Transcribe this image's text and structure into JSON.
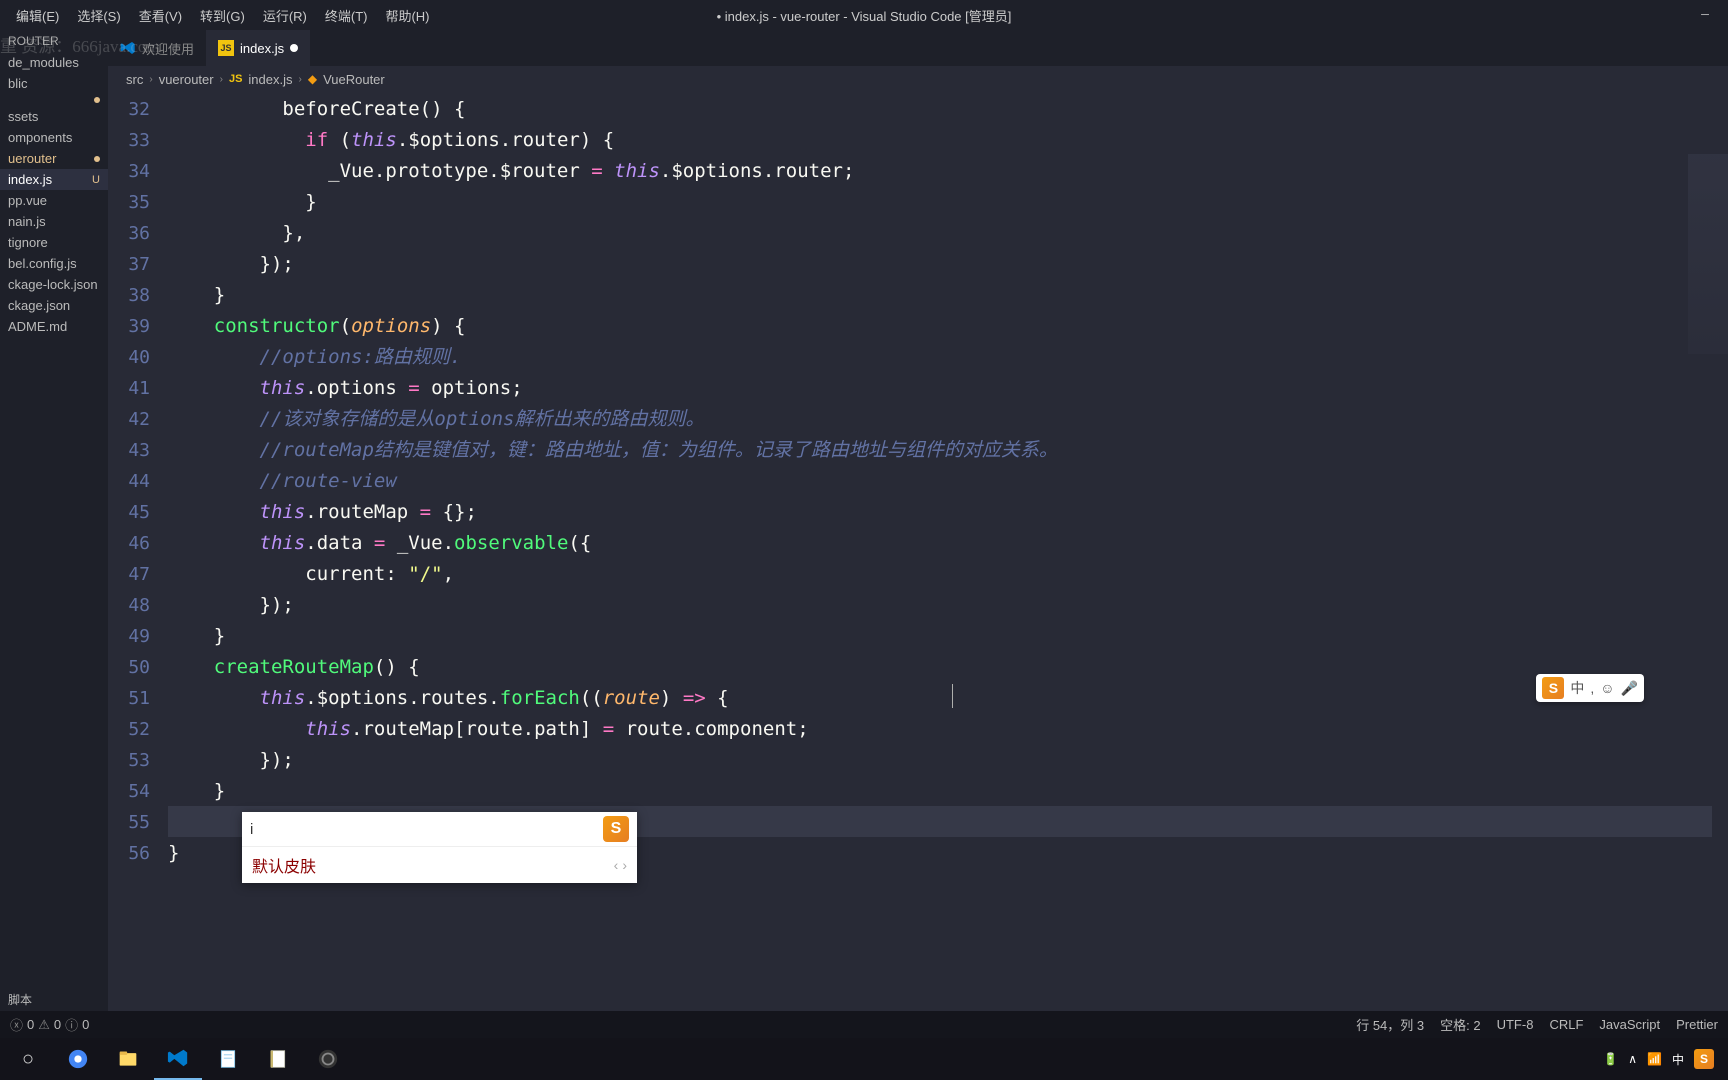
{
  "watermark": "重 资源：666java.com",
  "menubar": [
    "编辑(E)",
    "选择(S)",
    "查看(V)",
    "转到(G)",
    "运行(R)",
    "终端(T)",
    "帮助(H)"
  ],
  "window_title": "• index.js - vue-router - Visual Studio Code [管理员]",
  "sidebar": {
    "header": "ROUTER",
    "items": [
      {
        "label": "de_modules",
        "mod": false
      },
      {
        "label": "blic",
        "mod": false
      },
      {
        "label": "",
        "dot": true
      },
      {
        "label": "ssets",
        "mod": false
      },
      {
        "label": "omponents",
        "mod": false
      },
      {
        "label": "uerouter",
        "mod": true,
        "dot": true
      },
      {
        "label": "index.js",
        "mod": true,
        "active": true,
        "badge": "U"
      },
      {
        "label": "pp.vue",
        "mod": false
      },
      {
        "label": "nain.js",
        "mod": false
      },
      {
        "label": "tignore",
        "mod": false
      },
      {
        "label": "bel.config.js",
        "mod": false
      },
      {
        "label": "ckage-lock.json",
        "mod": false
      },
      {
        "label": "ckage.json",
        "mod": false
      },
      {
        "label": "ADME.md",
        "mod": false
      }
    ]
  },
  "tabs": [
    {
      "label": "欢迎使用",
      "icon": "vscode",
      "active": false
    },
    {
      "label": "index.js",
      "icon": "js",
      "active": true,
      "dirty": true
    }
  ],
  "breadcrumb": [
    "src",
    "vuerouter",
    "index.js",
    "VueRouter"
  ],
  "line_numbers": [
    "",
    "32",
    "33",
    "34",
    "35",
    "36",
    "37",
    "38",
    "39",
    "40",
    "41",
    "42",
    "43",
    "44",
    "45",
    "46",
    "47",
    "48",
    "49",
    "50",
    "51",
    "52",
    "53",
    "54",
    "55",
    "56"
  ],
  "code_lines": [
    {
      "t": "partial",
      "indent": 10,
      "html": "<span class='prop'>beforeCreate</span>() {"
    },
    {
      "indent": 12,
      "html": "<span class='kw2'>if</span> (<span class='this'>this</span>.$options.router) {"
    },
    {
      "indent": 14,
      "html": "_Vue.prototype.$router <span class='kw2'>=</span> <span class='this'>this</span>.$options.router;"
    },
    {
      "indent": 12,
      "html": "}"
    },
    {
      "indent": 10,
      "html": "},"
    },
    {
      "indent": 8,
      "html": "});"
    },
    {
      "indent": 4,
      "html": "}"
    },
    {
      "indent": 4,
      "html": "<span class='fn'>constructor</span>(<span class='param'>options</span>) {"
    },
    {
      "indent": 8,
      "html": "<span class='cmt'>//options:路由规则.</span>"
    },
    {
      "indent": 8,
      "html": "<span class='this'>this</span>.options <span class='kw2'>=</span> options;"
    },
    {
      "indent": 8,
      "html": "<span class='cmt'>//该对象存储的是从options解析出来的路由规则。</span>"
    },
    {
      "indent": 8,
      "html": "<span class='cmt'>//routeMap结构是键值对，键：路由地址，值：为组件。记录了路由地址与组件的对应关系。</span>"
    },
    {
      "indent": 8,
      "html": "<span class='cmt'>//route-view</span>"
    },
    {
      "indent": 8,
      "html": "<span class='this'>this</span>.routeMap <span class='kw2'>=</span> {};"
    },
    {
      "indent": 8,
      "html": "<span class='this'>this</span>.data <span class='kw2'>=</span> _Vue.<span class='method'>observable</span>({"
    },
    {
      "indent": 12,
      "html": "<span class='prop'>current</span>: <span class='str'>\"/\"</span>,"
    },
    {
      "indent": 8,
      "html": "});"
    },
    {
      "indent": 4,
      "html": "}"
    },
    {
      "indent": 4,
      "html": "<span class='fn'>createRouteMap</span>() {"
    },
    {
      "indent": 8,
      "html": "<span class='this'>this</span>.$options.routes.<span class='method'>forEach</span>((<span class='param'>route</span>) <span class='kw2'>=></span> {"
    },
    {
      "indent": 12,
      "html": "<span class='this'>this</span>.routeMap[route.path] <span class='kw2'>=</span> route.component;"
    },
    {
      "indent": 8,
      "html": "});"
    },
    {
      "indent": 4,
      "html": "}"
    },
    {
      "indent": 4,
      "html": ""
    },
    {
      "indent": 0,
      "html": "}"
    },
    {
      "indent": 0,
      "html": ""
    }
  ],
  "ime": {
    "input": "i",
    "candidate": "默认皮肤",
    "logo": "S"
  },
  "statusbar": {
    "errors": "0",
    "warnings": "0",
    "infos": "0",
    "line_col": "行 54，列 3",
    "spaces": "空格: 2",
    "encoding": "UTF-8",
    "eol": "CRLF",
    "language": "JavaScript",
    "prettier": "Prettier"
  },
  "bottom_panel": {
    "line1": "",
    "line2": "脚本"
  },
  "floating_ime": {
    "items": [
      "中",
      ",",
      "☺",
      "🎤"
    ]
  },
  "taskbar": {
    "tray": [
      "🔋",
      "∧",
      "📶",
      "中"
    ]
  }
}
